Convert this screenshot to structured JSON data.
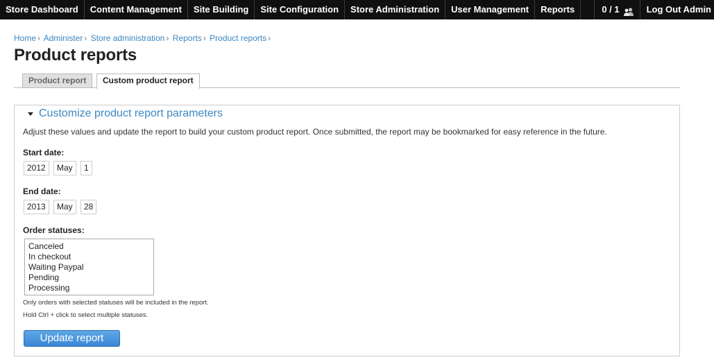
{
  "admin_bar": {
    "menu": [
      {
        "label": "Store Dashboard"
      },
      {
        "label": "Content Management"
      },
      {
        "label": "Site Building"
      },
      {
        "label": "Site Configuration"
      },
      {
        "label": "Store Administration"
      },
      {
        "label": "User Management"
      },
      {
        "label": "Reports"
      }
    ],
    "users_online": "0 / 1",
    "users_icon": "users-icon",
    "logout_label": "Log Out Admin"
  },
  "breadcrumb": [
    "Home",
    "Administer",
    "Store administration",
    "Reports",
    "Product reports"
  ],
  "breadcrumb_separator": "›",
  "page_title": "Product reports",
  "tabs": [
    {
      "label": "Product report",
      "active": false
    },
    {
      "label": "Custom product report",
      "active": true
    }
  ],
  "fieldset": {
    "legend": "Customize product report parameters",
    "description": "Adjust these values and update the report to build your custom product report. Once submitted, the report may be bookmarked for easy reference in the future.",
    "start_date": {
      "label": "Start date:",
      "year": "2012",
      "month": "May",
      "day": "1"
    },
    "end_date": {
      "label": "End date:",
      "year": "2013",
      "month": "May",
      "day": "28"
    },
    "order_statuses": {
      "label": "Order statuses:",
      "options": [
        "Canceled",
        "In checkout",
        "Waiting Paypal",
        "Pending",
        "Processing"
      ],
      "help_1": "Only orders with selected statuses will be included in the report.",
      "help_2": "Hold Ctrl + click to select multiple statuses."
    },
    "submit_label": "Update report"
  },
  "colors": {
    "link": "#3a87c2",
    "bar": "#101010",
    "button": "#3a86d3"
  }
}
